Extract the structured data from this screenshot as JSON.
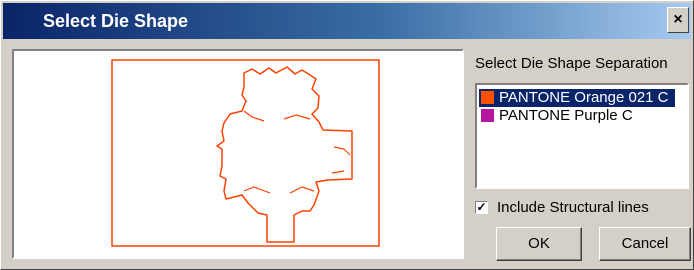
{
  "window": {
    "title": "Select Die Shape",
    "close_glyph": "×"
  },
  "preview": {
    "line_color": "#ff4000"
  },
  "separations": {
    "label": "Select Die Shape Separation",
    "items": [
      {
        "label": "PANTONE Orange 021 C",
        "color": "#ff5000",
        "selected": true
      },
      {
        "label": "PANTONE Purple C",
        "color": "#b4169e",
        "selected": false
      }
    ]
  },
  "options": {
    "include_structural_label": "Include Structural lines",
    "include_structural_checked": true,
    "check_glyph": "✓"
  },
  "buttons": {
    "ok": "OK",
    "cancel": "Cancel"
  }
}
